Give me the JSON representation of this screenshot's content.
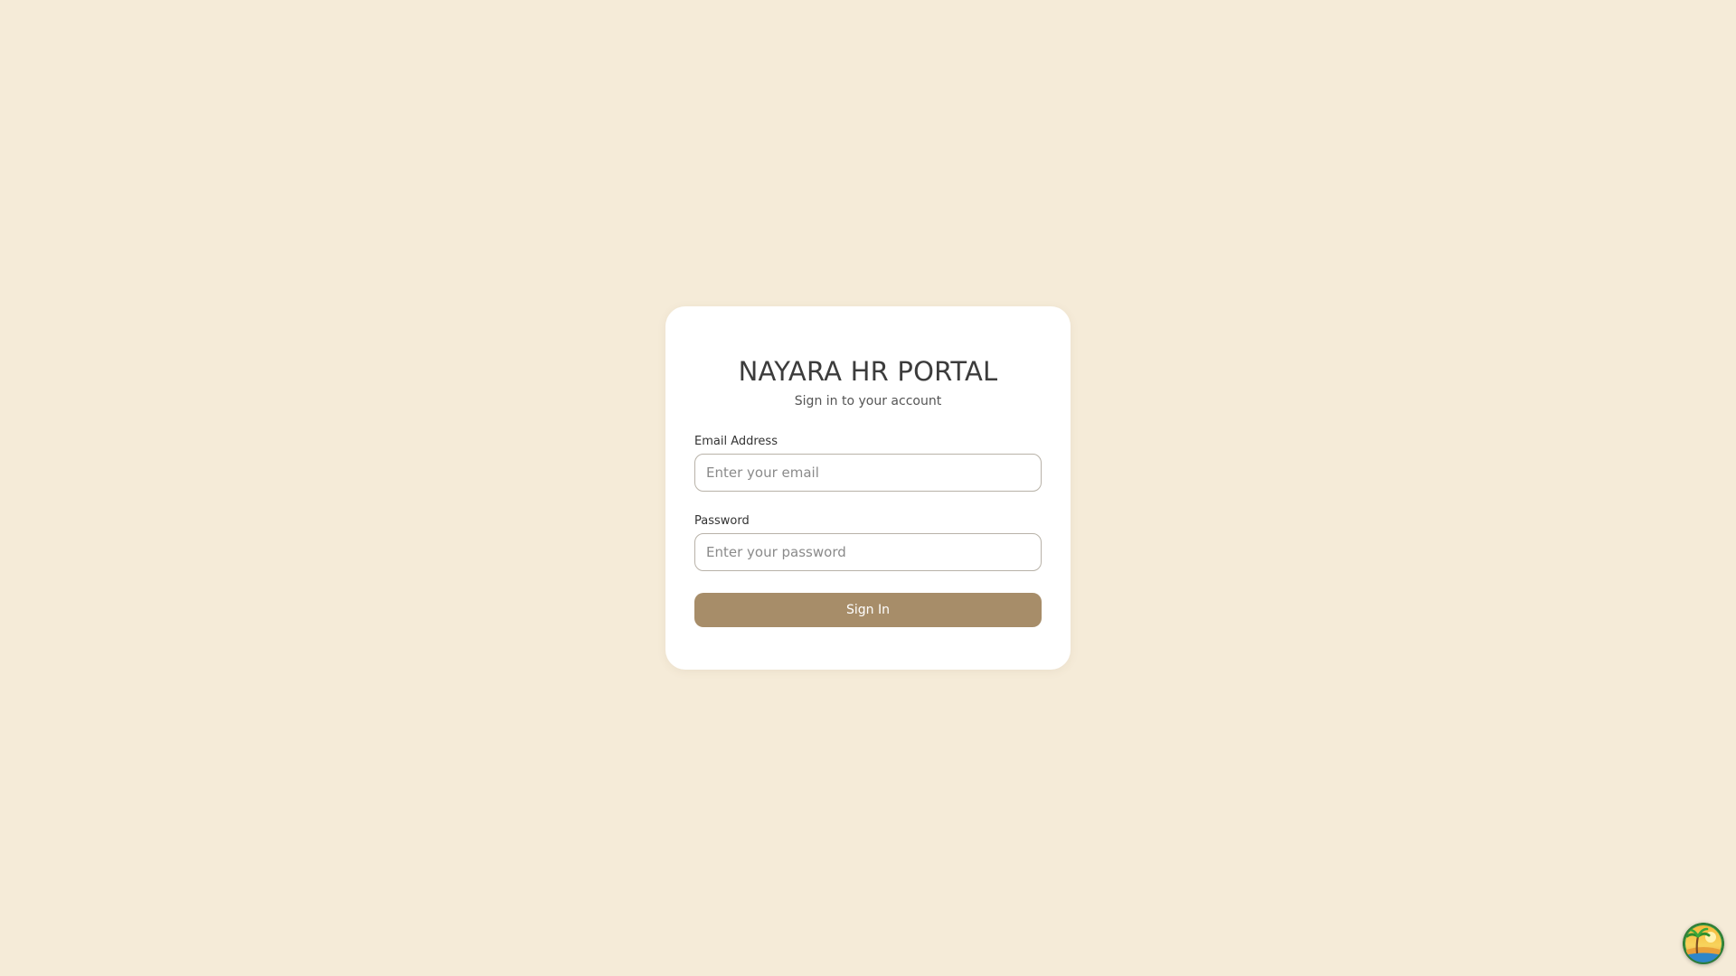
{
  "login": {
    "title": "NAYARA HR PORTAL",
    "subtitle": "Sign in to your account",
    "email_label": "Email Address",
    "email_placeholder": "Enter your email",
    "email_value": "",
    "password_label": "Password",
    "password_placeholder": "Enter your password",
    "password_value": "",
    "submit_label": "Sign In"
  },
  "floating_widget": {
    "icon": "palm-tree-sunset-icon"
  },
  "colors": {
    "background": "#f5ebd8",
    "card": "#ffffff",
    "button": "#a78d69",
    "button_text": "#ffffff"
  }
}
